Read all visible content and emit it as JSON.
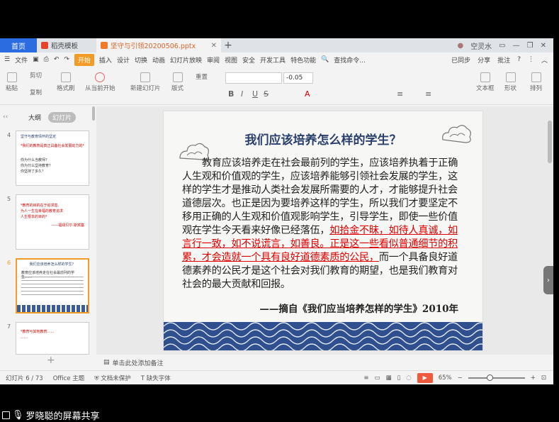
{
  "tabs": {
    "home": "首页",
    "template": "稻壳模板",
    "file": "坚守与引领20200506.pptx",
    "user": "空灵水"
  },
  "menu": {
    "file": "文件",
    "start": "开始",
    "items": [
      "插入",
      "设计",
      "切换",
      "动画",
      "幻灯片放映",
      "审阅",
      "视图",
      "安全",
      "开发工具",
      "特色功能"
    ],
    "search": "查找命令...",
    "sync": "已同步",
    "share": "分享",
    "comment": "批注"
  },
  "ribbon": {
    "paste": "粘贴",
    "cut": "剪切",
    "copy": "复制",
    "format_painter": "格式刷",
    "from_current": "从当前开始",
    "new_slide": "新建幻灯片",
    "layout": "版式",
    "reset": "重置",
    "font_size": "-0.05",
    "textbox": "文本框",
    "shape": "形状",
    "arrange": "排列"
  },
  "panel": {
    "outline": "大纲",
    "slides": "幻灯片"
  },
  "thumbnails": [
    {
      "num": "4",
      "title": "坚守与教育情怀的坚定",
      "lines": [
        "*我们的教育是真正具备社会发展动力的*",
        "你为什么当教师？",
        "你为什么坚持教育？",
        "你坚持了多久？"
      ]
    },
    {
      "num": "5",
      "title": "",
      "lines": [
        "*教育的目的在于追求善,",
        "为人一生在幸福的教育追求",
        "人生根本的目的*",
        "——福禄贝尔·斯宾塞"
      ]
    },
    {
      "num": "6",
      "title": "我们应该培养怎么样的学生？",
      "lines": [
        "教育应该培养走在社会最前列的学生……"
      ]
    },
    {
      "num": "7",
      "title": "",
      "lines": [
        "*教育与其他教育……",
        "……"
      ]
    }
  ],
  "slide": {
    "title": "我们应该培养怎么样的学生？",
    "body_1": "教育应该培养走在社会最前列的学生，应该培养执着于正确人生观和价值观的学生，应该培养能够引领社会发展的学生，这样的学生才是推动人类社会发展所需要的人才，才能够提升社会道德层次。也正是因为要培养这样的学生，所以我们才要坚定不移用正确的人生观和价值观影响学生，引导学生，即使一些价值观在学生今天看来好像已经落伍，",
    "body_red": "如拾金不昧，如待人真诚，如言行一致，如不说谎言，如善良。正是这一些看似普通细节的积累，才会造就一个具有良好道德素质的公民，",
    "body_2": "而一个具备良好道德素养的公民才是这个社会对我们教育的期望，也是我们教育对社会的最大贡献和回报。",
    "source": "——摘自《我们应当培养怎样的学生》2010年"
  },
  "notes": "单击此处添加备注",
  "status": {
    "slide_count": "幻灯片 6 / 73",
    "theme": "Office 主题",
    "protect": "文档未保护",
    "font_missing": "缺失字体",
    "zoom": "65%"
  },
  "screen_share": "罗晓聪的屏幕共享"
}
